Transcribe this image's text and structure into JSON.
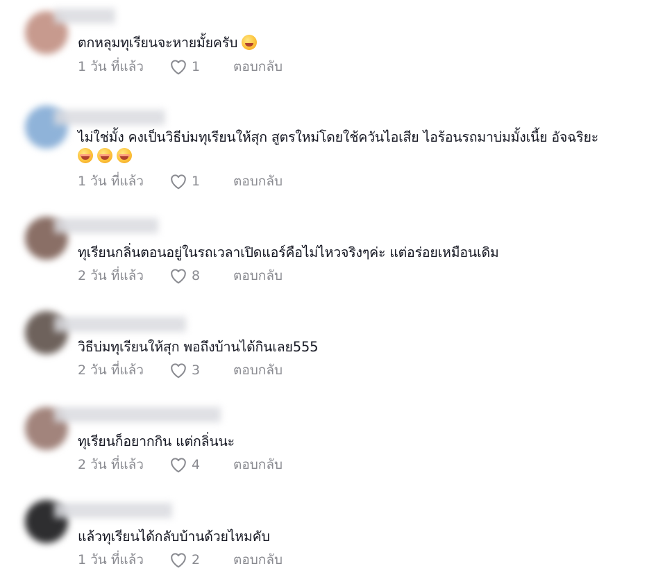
{
  "comments": [
    {
      "text_lines": [
        "ตกหลุมทุเรียนจะหายมั้ยครับ"
      ],
      "emoji": [
        "laughing-tears-icon"
      ],
      "time": "1 วัน ที่แล้ว",
      "likes": "1",
      "reply": "ตอบกลับ",
      "avatar_color": "#c79a8e"
    },
    {
      "text_lines": [
        "ไม่ใช่มั้ง คงเป็นวิธีบ่มทุเรียนให้สุก สูตรใหม่โดยใช้ควันไอเสีย ไอร้อนรถมาบ่มมั้งเนี้ย อัจฉริยะ"
      ],
      "emoji": [
        "blush-giggle-icon",
        "blush-giggle-icon",
        "blush-giggle-icon"
      ],
      "time": "1 วัน ที่แล้ว",
      "likes": "1",
      "reply": "ตอบกลับ",
      "avatar_color": "#8fb3d9"
    },
    {
      "text_lines": [
        "ทุเรียนกลิ่นตอนอยู่ในรถเวลาเปิดแอร์คือไม่ไหวจริงๆค่ะ แต่อร่อยเหมือนเดิม"
      ],
      "emoji": [],
      "time": "2 วัน ที่แล้ว",
      "likes": "8",
      "reply": "ตอบกลับ",
      "avatar_color": "#8a6f66"
    },
    {
      "text_lines": [
        "วิธีบ่มทุเรียนให้สุก พอถึงบ้านได้กินเลย555"
      ],
      "emoji": [],
      "time": "2 วัน ที่แล้ว",
      "likes": "3",
      "reply": "ตอบกลับ",
      "avatar_color": "#6e625c"
    },
    {
      "text_lines": [
        "ทุเรียนก็อยากกิน แต่กลิ่นนะ"
      ],
      "emoji": [],
      "time": "2 วัน ที่แล้ว",
      "likes": "4",
      "reply": "ตอบกลับ",
      "avatar_color": "#a2847c"
    },
    {
      "text_lines": [
        "แล้วทุเรียนได้กลับบ้านด้วยไหมคับ"
      ],
      "emoji": [],
      "time": "1 วัน ที่แล้ว",
      "likes": "2",
      "reply": "ตอบกลับ",
      "avatar_color": "#2e2e30"
    }
  ],
  "colors": {
    "text": "#161823",
    "muted": "#8a8b91"
  }
}
